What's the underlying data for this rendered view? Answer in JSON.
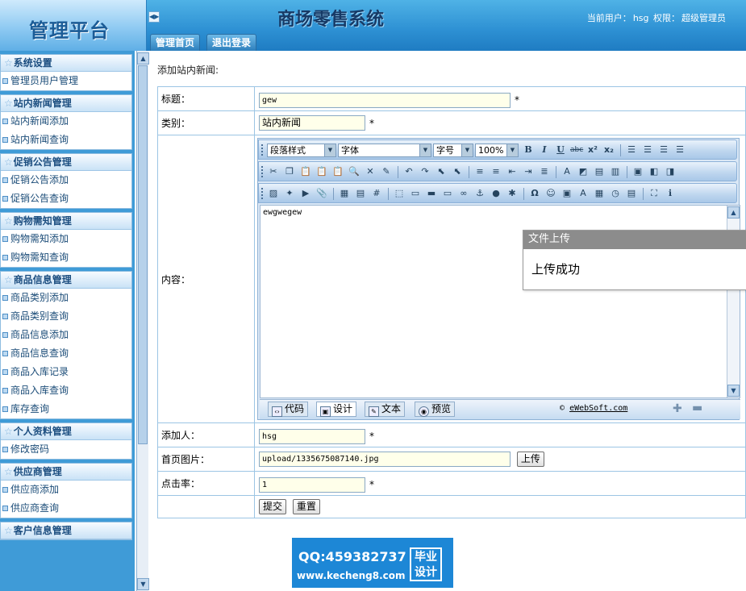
{
  "header": {
    "logo": "管理平台",
    "system_title": "商场零售系统",
    "user_label": "当前用户：",
    "user_name": "hsg",
    "role_label": "权限：",
    "role": "超级管理员",
    "tabs": [
      "管理首页",
      "退出登录"
    ]
  },
  "sidebar": {
    "groups": [
      {
        "title": "系统设置",
        "items": [
          "管理员用户管理"
        ]
      },
      {
        "title": "站内新闻管理",
        "items": [
          "站内新闻添加",
          "站内新闻查询"
        ]
      },
      {
        "title": "促销公告管理",
        "items": [
          "促销公告添加",
          "促销公告查询"
        ]
      },
      {
        "title": "购物需知管理",
        "items": [
          "购物需知添加",
          "购物需知查询"
        ]
      },
      {
        "title": "商品信息管理",
        "items": [
          "商品类别添加",
          "商品类别查询",
          "商品信息添加",
          "商品信息查询",
          "商品入库记录",
          "商品入库查询",
          "库存查询"
        ]
      },
      {
        "title": "个人资料管理",
        "items": [
          "修改密码"
        ]
      },
      {
        "title": "供应商管理",
        "items": [
          "供应商添加",
          "供应商查询"
        ]
      },
      {
        "title": "客户信息管理",
        "items": []
      }
    ]
  },
  "main": {
    "page_title": "添加站内新闻:",
    "required_mark": "*",
    "fields": {
      "title_label": "标题：",
      "title_value": "gew",
      "category_label": "类别：",
      "category_value": "站内新闻",
      "content_label": "内容：",
      "content_value": "ewgwegew",
      "author_label": "添加人：",
      "author_value": "hsg",
      "image_label": "首页图片：",
      "image_value": "upload/1335675087140.jpg",
      "upload_button": "上传",
      "clicks_label": "点击率：",
      "clicks_value": "1"
    },
    "buttons": {
      "submit": "提交",
      "reset": "重置"
    }
  },
  "editor": {
    "paragraph_style": "段落样式",
    "font": "字体",
    "font_size": "字号",
    "zoom": "100%",
    "modes": [
      "代码",
      "设计",
      "文本",
      "预览"
    ],
    "copyright_symbol": "©",
    "copyright_link": "eWebSoft.com"
  },
  "dialog": {
    "title": "文件上传",
    "message": "上传成功"
  },
  "watermark": {
    "qq": "QQ:459382737",
    "url": "www.kecheng8.com",
    "badge_line1": "毕业",
    "badge_line2": "设计"
  },
  "colors": {
    "header_blue": "#2d90d3",
    "sidebar_blue": "#3f9bd7",
    "border": "#9cc5e4",
    "input_bg": "#ffffea"
  }
}
